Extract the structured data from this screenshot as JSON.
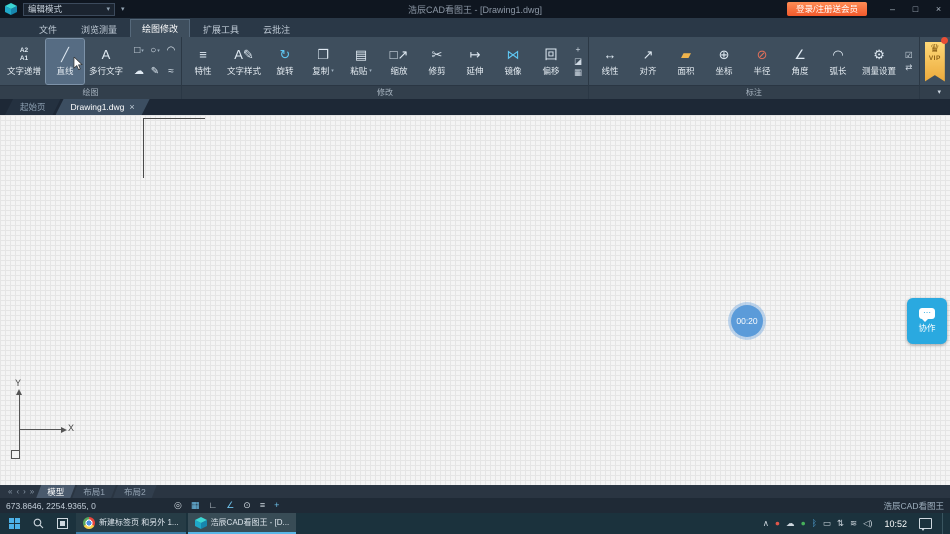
{
  "colors": {
    "accent": "#4db2e8",
    "login_orange": "#f2592b",
    "collab_blue": "#2aa9e0",
    "vip_gold": "#f5c14e"
  },
  "titlebar": {
    "mode_dropdown": "编辑模式",
    "title": "浩辰CAD看图王 - [Drawing1.dwg]",
    "login_button": "登录/注册送会员"
  },
  "window_controls": {
    "minimize": "–",
    "maximize": "□",
    "close": "×"
  },
  "menu_tabs": [
    {
      "label": "文件"
    },
    {
      "label": "浏览测量"
    },
    {
      "label": "绘图修改"
    },
    {
      "label": "扩展工具"
    },
    {
      "label": "云批注"
    }
  ],
  "ribbon": {
    "draw": {
      "name": "绘图",
      "text_increment": "文字递增",
      "line": "直线",
      "mtext": "多行文字"
    },
    "modify": {
      "name": "修改",
      "buttons": [
        "特性",
        "文字样式",
        "旋转",
        "复制",
        "粘贴",
        "缩放",
        "修剪",
        "延伸",
        "镜像",
        "偏移"
      ]
    },
    "dims": {
      "name": "标注",
      "buttons": [
        "线性",
        "对齐",
        "面积",
        "坐标",
        "半径",
        "角度",
        "弧长",
        "测量设置"
      ]
    },
    "vip": "VIP"
  },
  "icons": {
    "caret": "▾",
    "text_increment": "A2\nA1",
    "line": "╱",
    "mtext": "A",
    "rect": "□",
    "circle": "○",
    "arc": "◠",
    "cloud": "☁",
    "pencil": "✎",
    "spline": "≈",
    "properties": "≡",
    "text_style": "A✎",
    "rotate": "↻",
    "copy": "❐",
    "paste": "▤",
    "scale": "□↗",
    "trim": "✂",
    "extend": "↦",
    "mirror": "⋈",
    "offset": "回",
    "point": "+",
    "erase": "◪",
    "explode": "▦",
    "linear": "↔",
    "aligned": "↗",
    "area": "▰",
    "coord": "⊕",
    "radius": "⊘",
    "angle": "∠",
    "arc_len": "◠",
    "measure_settings": "⚙",
    "dim_list": "☑",
    "dim_swap": "⇄",
    "crown": "♛",
    "close_tab": "×",
    "collab_dots": "⋯",
    "nav_first": "«",
    "nav_prev": "‹",
    "nav_next": "›",
    "nav_last": "»",
    "status": [
      "◎",
      "▦",
      "∟",
      "∠",
      "⊙",
      "≡",
      "+"
    ],
    "tray": [
      "∧",
      "●",
      "☁",
      "●",
      "ᛒ",
      "▭",
      "⇅",
      "≋",
      "◁)"
    ]
  },
  "doc_tabs": [
    {
      "label": "起始页"
    },
    {
      "label": "Drawing1.dwg"
    }
  ],
  "canvas": {
    "timer": "00:20",
    "collab_label": "协作",
    "ucs_x": "X",
    "ucs_y": "Y"
  },
  "layout_tabs": [
    {
      "label": "模型"
    },
    {
      "label": "布局1"
    },
    {
      "label": "布局2"
    }
  ],
  "statusbar": {
    "coordinates": "673.8646, 2254.9365, 0",
    "app_name": "浩辰CAD看图王"
  },
  "taskbar": {
    "apps": [
      {
        "label": "新建标签页 和另外 1..."
      },
      {
        "label": "浩辰CAD看图王 - [D..."
      }
    ],
    "time": "10:52"
  }
}
